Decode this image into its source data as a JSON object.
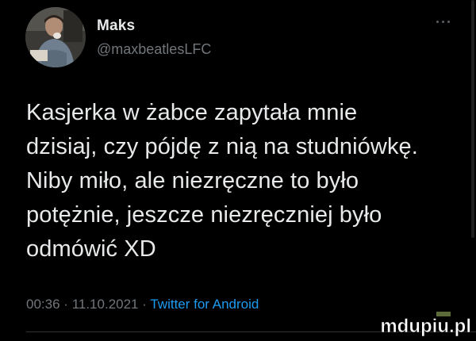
{
  "tweet": {
    "display_name": "Maks",
    "handle": "@maxbeatlesLFC",
    "text": "Kasjerka w żabce zapytała mnie\ndzisiaj, czy pójdę z nią na studniówkę.\nNiby miło, ale niezręczne to było\npotężnie, jeszcze niezręczniej było\nodmówić XD",
    "time": "00:36",
    "date": "11.10.2021",
    "separator": "·",
    "source": "Twitter for Android"
  },
  "icons": {
    "more": "more-horizontal-icon",
    "avatar": "profile-photo"
  },
  "watermark": {
    "text": "mdupiu.pl"
  },
  "colors": {
    "background": "#000000",
    "primary_text": "#e7e9ea",
    "secondary_text": "#71767b",
    "link": "#1d9bf0",
    "divider": "#2f3336"
  }
}
